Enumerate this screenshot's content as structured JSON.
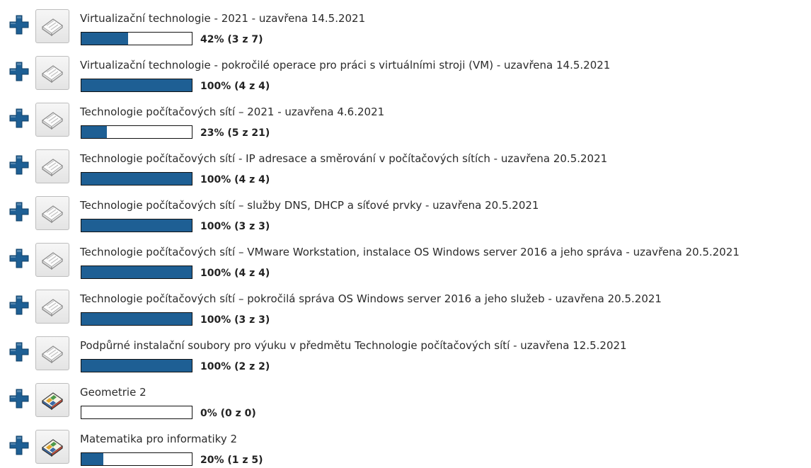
{
  "colors": {
    "accent": "#1e5f94",
    "expand_icon": "#1e5f94"
  },
  "icons": {
    "expand": "plus-icon",
    "course": "book-icon"
  },
  "courses": [
    {
      "title": "Virtualizační technologie - 2021 - uzavřena 14.5.2021",
      "progress": 0.42,
      "progress_label": "42% (3 z 7)",
      "icon_style": "plain"
    },
    {
      "title": "Virtualizační technologie - pokročilé operace pro práci s virtuálními stroji (VM) - uzavřena 14.5.2021",
      "progress": 1.0,
      "progress_label": "100% (4 z 4)",
      "icon_style": "plain"
    },
    {
      "title": "Technologie počítačových sítí – 2021 - uzavřena 4.6.2021",
      "progress": 0.23,
      "progress_label": "23% (5 z 21)",
      "icon_style": "plain"
    },
    {
      "title": "Technologie počítačových sítí - IP adresace a směrování v počítačových sítích - uzavřena 20.5.2021",
      "progress": 1.0,
      "progress_label": "100% (4 z 4)",
      "icon_style": "plain"
    },
    {
      "title": "Technologie počítačových sítí – služby DNS, DHCP a síťové prvky - uzavřena 20.5.2021",
      "progress": 1.0,
      "progress_label": "100% (3 z 3)",
      "icon_style": "plain"
    },
    {
      "title": "Technologie počítačových sítí – VMware Workstation, instalace OS Windows server 2016 a jeho správa - uzavřena 20.5.2021",
      "progress": 1.0,
      "progress_label": "100% (4 z 4)",
      "icon_style": "plain"
    },
    {
      "title": "Technologie počítačových sítí – pokročilá správa OS Windows server 2016 a jeho služeb - uzavřena 20.5.2021",
      "progress": 1.0,
      "progress_label": "100% (3 z 3)",
      "icon_style": "plain"
    },
    {
      "title": "Podpůrné instalační soubory pro výuku v předmětu Technologie počítačových sítí - uzavřena 12.5.2021",
      "progress": 1.0,
      "progress_label": "100% (2 z 2)",
      "icon_style": "plain"
    },
    {
      "title": "Geometrie 2",
      "progress": 0.0,
      "progress_label": "0% (0 z 0)",
      "icon_style": "colored"
    },
    {
      "title": "Matematika pro informatiky 2",
      "progress": 0.2,
      "progress_label": "20% (1 z 5)",
      "icon_style": "colored"
    }
  ]
}
